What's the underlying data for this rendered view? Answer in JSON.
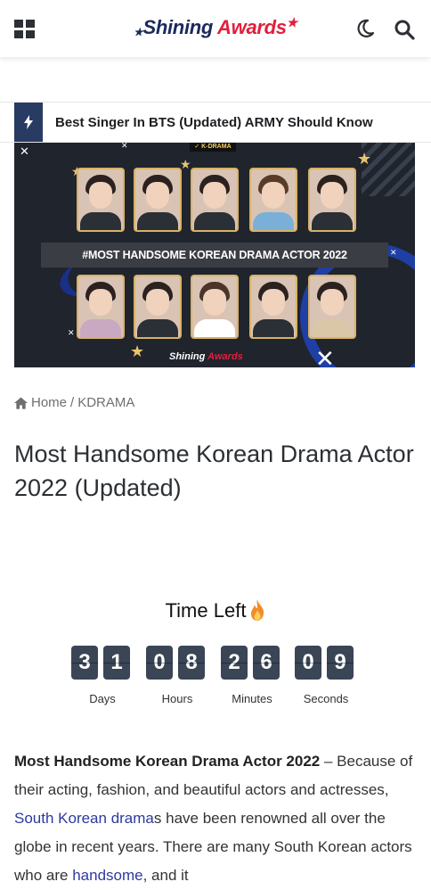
{
  "header": {
    "logo_part1": "Shining",
    "logo_part2": "Awards",
    "menu_icon": "grid-menu-icon",
    "theme_icon": "moon-icon",
    "search_icon": "search-icon"
  },
  "breaking": {
    "icon": "bolt-icon",
    "headline": "Best Singer In BTS (Updated) ARMY Should Know"
  },
  "featured": {
    "badge": "✓ K-DRAMA",
    "banner_title": "#MOST HANDSOME KOREAN DRAMA ACTOR 2022",
    "logo_part1": "Shining",
    "logo_part2": "Awards",
    "close_glyph": "✕"
  },
  "breadcrumb": {
    "home": "Home",
    "separator": "/",
    "category": "KDRAMA"
  },
  "post": {
    "title": "Most Handsome Korean Drama Actor 2022 (Updated)"
  },
  "countdown": {
    "heading": "Time Left",
    "days": [
      "3",
      "1"
    ],
    "hours": [
      "0",
      "8"
    ],
    "minutes": [
      "2",
      "6"
    ],
    "seconds": [
      "0",
      "9"
    ],
    "days_label": "Days",
    "hours_label": "Hours",
    "minutes_label": "Minutes",
    "seconds_label": "Seconds"
  },
  "article": {
    "lead_bold": "Most Handsome Korean Drama Actor 2022",
    "text1": " – Because of their acting, fashion, and beautiful actors and actresses, ",
    "link1": "South Korean drama",
    "text2": "s have been renowned all over the globe in recent years. There are many South Korean actors who are ",
    "link2": "handsome",
    "text3": ", and it"
  },
  "colors": {
    "brand_navy": "#1b2a5c",
    "brand_red": "#e31e3c",
    "accent_bar": "#283b63",
    "digit_bg": "#3a4556",
    "link": "#2d3a9e"
  }
}
